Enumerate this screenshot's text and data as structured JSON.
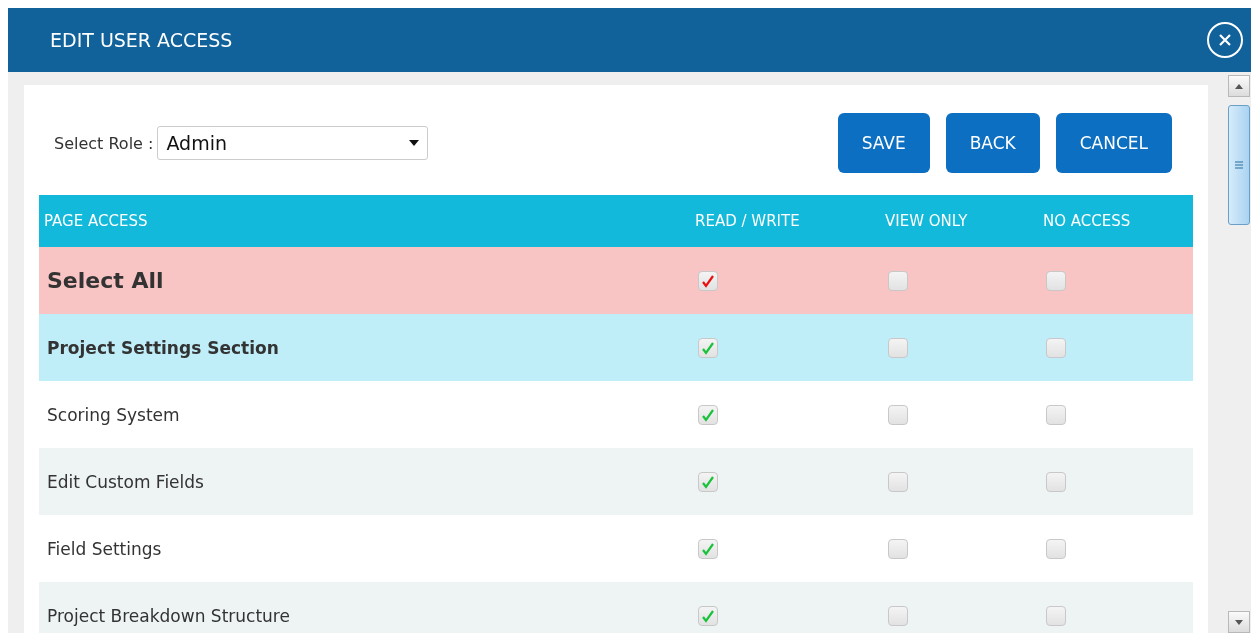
{
  "dialog": {
    "title": "EDIT USER ACCESS"
  },
  "role": {
    "label": "Select Role :",
    "value": "Admin"
  },
  "buttons": [
    "SAVE",
    "BACK",
    "CANCEL"
  ],
  "table": {
    "columns": [
      "PAGE ACCESS",
      "READ / WRITE",
      "VIEW ONLY",
      "NO ACCESS"
    ],
    "rows": [
      {
        "kind": "select_all",
        "name": "Select All",
        "read_write": true,
        "view_only": false,
        "no_access": false
      },
      {
        "kind": "section",
        "name": "Project Settings Section",
        "read_write": true,
        "view_only": false,
        "no_access": false
      },
      {
        "kind": "item",
        "name": "Scoring System",
        "read_write": true,
        "view_only": false,
        "no_access": false
      },
      {
        "kind": "item",
        "name": "Edit Custom Fields",
        "read_write": true,
        "view_only": false,
        "no_access": false
      },
      {
        "kind": "item",
        "name": "Field Settings",
        "read_write": true,
        "view_only": false,
        "no_access": false
      },
      {
        "kind": "item",
        "name": "Project Breakdown Structure",
        "read_write": true,
        "view_only": false,
        "no_access": false
      }
    ]
  }
}
